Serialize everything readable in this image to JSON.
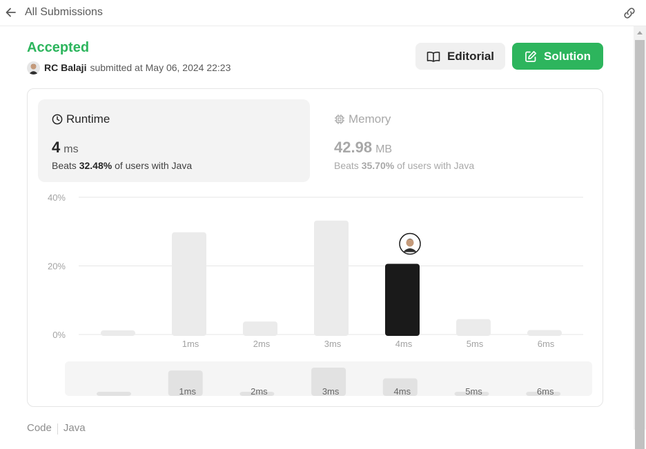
{
  "header": {
    "title": "All Submissions"
  },
  "submission": {
    "status": "Accepted",
    "author": "RC Balaji",
    "submitted_text": "submitted at May 06, 2024 22:23"
  },
  "actions": {
    "editorial_label": "Editorial",
    "solution_label": "Solution"
  },
  "stats": {
    "runtime": {
      "label": "Runtime",
      "value": "4",
      "unit": "ms",
      "beats_prefix": "Beats",
      "beats_pct": "32.48%",
      "beats_suffix": "of users with Java"
    },
    "memory": {
      "label": "Memory",
      "value": "42.98",
      "unit": "MB",
      "beats_prefix": "Beats",
      "beats_pct": "35.70%",
      "beats_suffix": "of users with Java"
    }
  },
  "code_tabs": [
    "Code",
    "Java"
  ],
  "colors": {
    "accent_green": "#2db55d",
    "bar_default": "#ebebeb",
    "bar_highlight": "#1a1a1a"
  },
  "chart_data": {
    "type": "bar",
    "categories": [
      "",
      "1ms",
      "2ms",
      "3ms",
      "4ms",
      "5ms",
      "6ms"
    ],
    "values": [
      1.2,
      29.8,
      3.8,
      33.2,
      20.6,
      4.5,
      1.3
    ],
    "highlight_index": 4,
    "y_ticks": [
      "0%",
      "20%",
      "40%"
    ],
    "ylim": [
      0,
      40
    ],
    "grid": true,
    "overview_labels": [
      "",
      "1ms",
      "2ms",
      "3ms",
      "4ms",
      "5ms",
      "6ms"
    ]
  }
}
